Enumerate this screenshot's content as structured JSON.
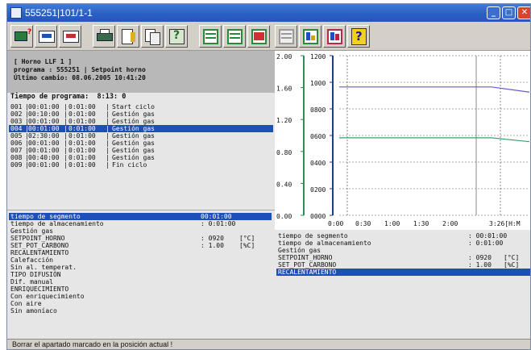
{
  "window": {
    "title": "555251|101/1-1",
    "controls": [
      "minimize",
      "maximize",
      "close"
    ]
  },
  "toolbar": {
    "buttons": [
      {
        "name": "monitor-query-button",
        "icon": "monitor-question-icon"
      },
      {
        "name": "insert-row-button",
        "icon": "insert-row-icon"
      },
      {
        "name": "delete-row-button",
        "icon": "delete-row-icon"
      },
      {
        "name": "print-button",
        "icon": "printer-icon"
      },
      {
        "name": "edit-document-button",
        "icon": "edit-document-icon"
      },
      {
        "name": "copy-button",
        "icon": "copy-icon"
      },
      {
        "name": "help-query-button",
        "icon": "help-query-icon"
      },
      {
        "name": "list-view-button",
        "icon": "list-green-icon"
      },
      {
        "name": "list-edit-button",
        "icon": "list-green-edit-icon"
      },
      {
        "name": "list-delete-button",
        "icon": "list-red-icon"
      },
      {
        "name": "list-disabled-button",
        "icon": "list-gray-icon"
      },
      {
        "name": "chart-list-button",
        "icon": "chart-list-icon"
      },
      {
        "name": "chart-edit-button",
        "icon": "chart-edit-icon"
      },
      {
        "name": "help-button",
        "icon": "question-mark-icon"
      }
    ]
  },
  "info": {
    "line1": "[ Horno LLF 1 ]",
    "line2": "programa : 555251 | Setpoint horno",
    "line3": "Último cambio: 08.06.2005 10:41:20"
  },
  "program": {
    "header_label": "Tiempo de programa:",
    "header_value": "8:13: 0",
    "rows": [
      {
        "num": "001",
        "t1": "00:01:00",
        "t2": "0:01:00",
        "desc": "Start ciclo",
        "selected": false
      },
      {
        "num": "002",
        "t1": "00:10:00",
        "t2": "0:01:00",
        "desc": "Gestión gas",
        "selected": false
      },
      {
        "num": "003",
        "t1": "00:01:00",
        "t2": "0:01:00",
        "desc": "Gestión gas",
        "selected": false
      },
      {
        "num": "004",
        "t1": "00:01:00",
        "t2": "0:01:00",
        "desc": "Gestión gas",
        "selected": true
      },
      {
        "num": "005",
        "t1": "02:30:00",
        "t2": "0:01:00",
        "desc": "Gestión gas",
        "selected": false
      },
      {
        "num": "006",
        "t1": "00:01:00",
        "t2": "0:01:00",
        "desc": "Gestión gas",
        "selected": false
      },
      {
        "num": "007",
        "t1": "00:01:00",
        "t2": "0:01:00",
        "desc": "Gestión gas",
        "selected": false
      },
      {
        "num": "008",
        "t1": "00:40:00",
        "t2": "0:01:00",
        "desc": "Gestión gas",
        "selected": false
      },
      {
        "num": "009",
        "t1": "00:01:00",
        "t2": "0:01:00",
        "desc": "Fin ciclo",
        "selected": false
      }
    ]
  },
  "params_left": [
    {
      "label": "tiempo de segmento",
      "value": "00:01:00",
      "unit": "",
      "selected": true
    },
    {
      "label": "tiempo de almacenamiento",
      "value": ": 0:01:00",
      "unit": "",
      "selected": false
    },
    {
      "label": "Gestión gas",
      "value": "",
      "unit": "",
      "selected": false
    },
    {
      "label": "SETPOINT_HORNO",
      "value": ": 0920",
      "unit": "[°C]",
      "selected": false
    },
    {
      "label": "SET_POT_CARBONO",
      "value": ": 1.00",
      "unit": "[%C]",
      "selected": false
    },
    {
      "label": "RECALENTAMIENTO",
      "value": "",
      "unit": "",
      "selected": false
    },
    {
      "label": "Calefacción",
      "value": "",
      "unit": "",
      "selected": false
    },
    {
      "label": "Sin al. temperat.",
      "value": "",
      "unit": "",
      "selected": false
    },
    {
      "label": "TIPO DIFUSIÓN",
      "value": "",
      "unit": "",
      "selected": false
    },
    {
      "label": "Dif. manual",
      "value": "",
      "unit": "",
      "selected": false
    },
    {
      "label": "ENRIQUECIMIENTO",
      "value": "",
      "unit": "",
      "selected": false
    },
    {
      "label": "Con enriquecimiento",
      "value": "",
      "unit": "",
      "selected": false
    },
    {
      "label": "Con aire",
      "value": "",
      "unit": "",
      "selected": false
    },
    {
      "label": "Sin amoníaco",
      "value": "",
      "unit": "",
      "selected": false
    }
  ],
  "params_right": [
    {
      "label": "tiempo de segmento",
      "value": ": 00:01:00",
      "unit": "",
      "selected": false
    },
    {
      "label": "tiempo de almacenamiento",
      "value": ": 0:01:00",
      "unit": "",
      "selected": false
    },
    {
      "label": "Gestión gas",
      "value": "",
      "unit": "",
      "selected": false
    },
    {
      "label": "SETPOINT_HORNO",
      "value": ": 0920",
      "unit": "[°C]",
      "selected": false
    },
    {
      "label": "SET_POT_CARBONO",
      "value": ": 1.00",
      "unit": "[%C]",
      "selected": false
    },
    {
      "label": "RECALENTAMIENTO",
      "value": "",
      "unit": "",
      "selected": true
    }
  ],
  "status_text": "Borrar el apartado marcado en la posición actual !",
  "chart_data": {
    "type": "line",
    "left_axis": {
      "ticks": [
        "2.00",
        "1.60",
        "1.20",
        "0.80",
        "0.40",
        "0.00"
      ],
      "range": [
        0,
        2.0
      ]
    },
    "right_axis": {
      "ticks": [
        "1200",
        "1000",
        "0800",
        "0600",
        "0400",
        "0200",
        "0000"
      ],
      "range": [
        0,
        1200
      ]
    },
    "x_ticks": [
      "0:00",
      "0:30",
      "1:00",
      "1:30",
      "2:00",
      "3:26[H:M"
    ],
    "series": [
      {
        "color": "#6a5acd",
        "values_right_axis": [
          960,
          960,
          960,
          960,
          960,
          920
        ]
      },
      {
        "color": "#3aa06a",
        "values_left_axis": [
          0.95,
          0.95,
          0.95,
          0.95,
          0.95,
          0.9
        ]
      }
    ],
    "colors": {
      "left_axis": "#2e8b57",
      "right_axis": "#1e3c8c",
      "grid": "#555555"
    }
  }
}
